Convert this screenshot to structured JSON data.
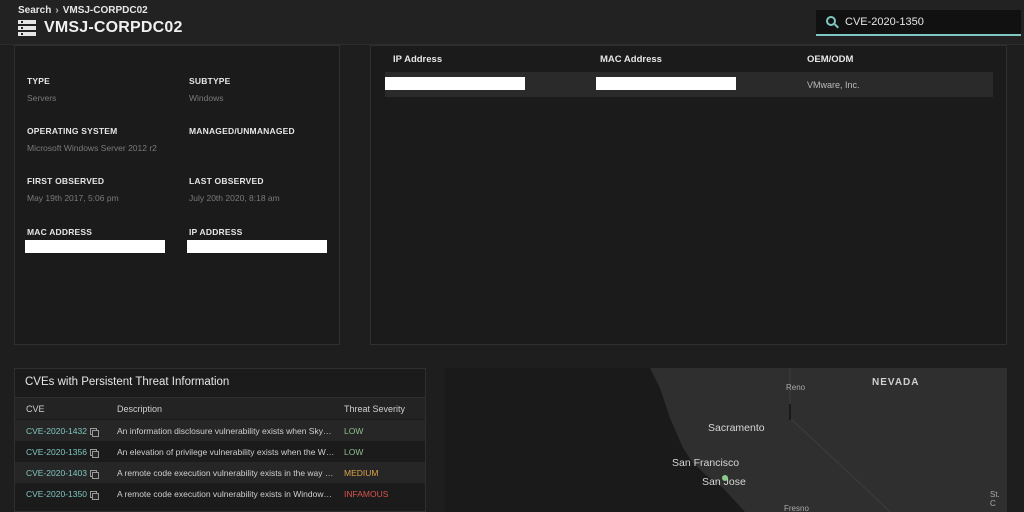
{
  "header": {
    "breadcrumb": [
      "Search",
      "VMSJ-CORPDC02"
    ],
    "breadcrumb_sep": "›",
    "title": "VMSJ-CORPDC02",
    "title_icon": "server-icon",
    "search": {
      "value": "CVE-2020-1350",
      "icon": "search-icon",
      "accent": "#7fc7c0"
    }
  },
  "device": {
    "type_label": "TYPE",
    "type_value": "Servers",
    "subtype_label": "SUBTYPE",
    "subtype_value": "Windows",
    "os_label": "OPERATING SYSTEM",
    "os_value": "Microsoft Windows Server 2012 r2",
    "managed_label": "MANAGED/UNMANAGED",
    "managed_value": "",
    "first_label": "FIRST OBSERVED",
    "first_value": "May 19th 2017, 5:06 pm",
    "last_label": "LAST OBSERVED",
    "last_value": "July 20th 2020, 8:18 am",
    "mac_label": "MAC ADDRESS",
    "ip_label": "IP ADDRESS"
  },
  "network": {
    "headers": [
      "IP Address",
      "MAC Address",
      "OEM/ODM"
    ],
    "oem": "VMware, Inc."
  },
  "cves": {
    "title": "CVEs with Persistent Threat Information",
    "headers": [
      "CVE",
      "Description",
      "Threat Severity"
    ],
    "rows": [
      {
        "id": "CVE-2020-1432",
        "description": "An information disclosure vulnerability exists when Skype for Business",
        "severity": "LOW",
        "color": "#8fbf8f"
      },
      {
        "id": "CVE-2020-1356",
        "description": "An elevation of privilege vulnerability exists when the Windows",
        "severity": "LOW",
        "color": "#8fbf8f"
      },
      {
        "id": "CVE-2020-1403",
        "description": "A remote code execution vulnerability exists in the way the",
        "severity": "MEDIUM",
        "color": "#d8a24a"
      },
      {
        "id": "CVE-2020-1350",
        "description": "A remote code execution vulnerability exists in Windows Domain Name",
        "severity": "INFAMOUS",
        "color": "#d9534f"
      }
    ]
  },
  "map": {
    "labels": {
      "nevada": "NEVADA",
      "reno": "Reno",
      "sacramento": "Sacramento",
      "san_francisco": "San Francisco",
      "san_jose": "San Jose",
      "fresno": "Fresno",
      "st": "St. C"
    }
  }
}
